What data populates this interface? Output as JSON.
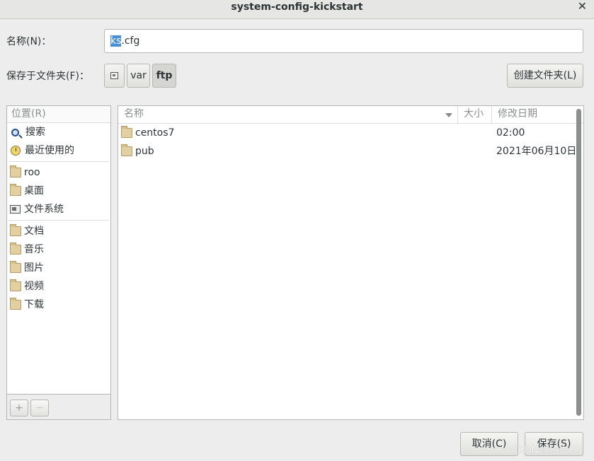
{
  "window": {
    "title": "system-config-kickstart",
    "close_glyph": "✕"
  },
  "name_row": {
    "label": "名称(N)：",
    "value_selected": "ks",
    "value_rest": ".cfg"
  },
  "folder_row": {
    "label": "保存于文件夹(F)：",
    "path": [
      "var",
      "ftp"
    ],
    "create_folder_label": "创建文件夹(L)"
  },
  "places": {
    "header": "位置(R)",
    "group1": [
      {
        "label": "搜索",
        "icon": "search-icon"
      },
      {
        "label": "最近使用的",
        "icon": "recent-icon"
      }
    ],
    "group2": [
      {
        "label": "roo",
        "icon": "home-folder-icon"
      },
      {
        "label": "桌面",
        "icon": "desktop-folder-icon"
      },
      {
        "label": "文件系统",
        "icon": "filesystem-icon"
      }
    ],
    "group3": [
      {
        "label": "文档",
        "icon": "documents-folder-icon"
      },
      {
        "label": "音乐",
        "icon": "music-folder-icon"
      },
      {
        "label": "图片",
        "icon": "pictures-folder-icon"
      },
      {
        "label": "视频",
        "icon": "videos-folder-icon"
      },
      {
        "label": "下载",
        "icon": "downloads-folder-icon"
      }
    ],
    "add_glyph": "+",
    "remove_glyph": "—"
  },
  "files": {
    "columns": {
      "name": "名称",
      "size": "大小",
      "modified": "修改日期"
    },
    "rows": [
      {
        "name": "centos7",
        "size": "",
        "modified": "02:00"
      },
      {
        "name": "pub",
        "size": "",
        "modified": "2021年06月10日"
      }
    ]
  },
  "buttons": {
    "cancel": "取消(C)",
    "save": "保存(S)"
  },
  "watermark": "CSDN @小白..."
}
